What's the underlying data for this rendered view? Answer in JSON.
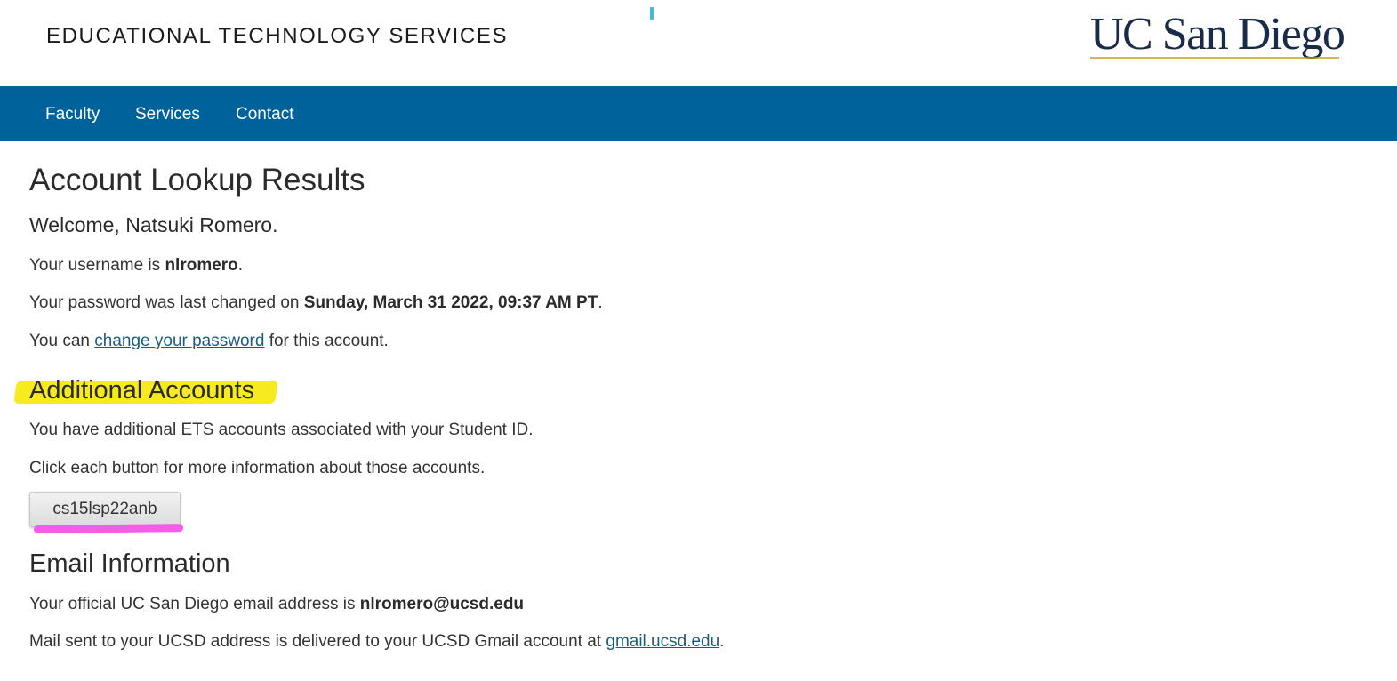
{
  "header": {
    "site_title": "EDUCATIONAL TECHNOLOGY SERVICES",
    "logo_text": "UC San Diego"
  },
  "nav": {
    "items": [
      {
        "label": "Faculty"
      },
      {
        "label": "Services"
      },
      {
        "label": "Contact"
      }
    ]
  },
  "main": {
    "title": "Account Lookup Results",
    "welcome": "Welcome, Natsuki Romero.",
    "username_prefix": "Your username is ",
    "username": "nlromero",
    "username_suffix": ".",
    "password_prefix": "Your password was last changed on ",
    "password_changed": "Sunday, March 31 2022, 09:37 AM PT",
    "password_suffix": ".",
    "change_prefix": "You can ",
    "change_link": "change your password",
    "change_suffix": " for this account."
  },
  "additional": {
    "heading": "Additional Accounts",
    "line1": "You have additional ETS accounts associated with your Student ID.",
    "line2": "Click each button for more information about those accounts.",
    "account_button": "cs15lsp22anb"
  },
  "email": {
    "heading": "Email Information",
    "official_prefix": "Your official UC San Diego email address is ",
    "address": "nlromero@ucsd.edu",
    "mail_prefix": "Mail sent to your UCSD address is delivered to your UCSD Gmail account at ",
    "gmail_link": "gmail.ucsd.edu",
    "mail_suffix": "."
  },
  "colors": {
    "nav_bg": "#00629b",
    "logo_navy": "#182b49",
    "logo_gold": "#c69214",
    "link": "#1c5d7a",
    "highlight_yellow": "#f7ea14",
    "highlight_pink": "#f55ce8"
  }
}
